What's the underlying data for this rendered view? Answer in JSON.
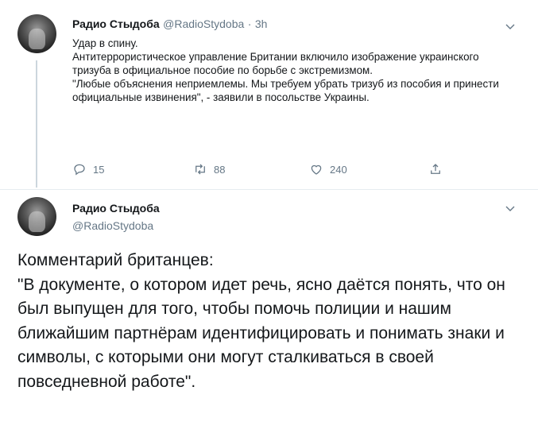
{
  "tweet1": {
    "author_name": "Радио Стыдоба",
    "handle": "@RadioStydoba",
    "separator": "·",
    "time": "3h",
    "body": [
      "Удар в спину.",
      "Антитеррористическое управление Британии включило изображение украинского тризуба в официальное пособие по борьбе с экстремизмом.",
      "\"Любые объяснения неприемлемы. Мы требуем убрать тризуб из пособия и принести официальные извинения\", - заявили в посольстве Украины."
    ],
    "replies": "15",
    "retweets": "88",
    "likes": "240"
  },
  "tweet2": {
    "author_name": "Радио Стыдоба",
    "handle": "@RadioStydoba",
    "body": [
      "Комментарий британцев:",
      "\"В документе, о котором идет речь, ясно даётся понять, что он был выпущен для того, чтобы помочь полиции и нашим ближайшим партнёрам идентифицировать и понимать знаки и символы, с которыми они могут сталкиваться в своей повседневной работе\"."
    ]
  },
  "colors": {
    "text": "#14171a",
    "secondary": "#657786",
    "divider": "#e6ecf0",
    "thread_line": "#ccd6dd"
  },
  "icons": [
    "reply-icon",
    "retweet-icon",
    "like-icon",
    "share-icon",
    "chevron-down-icon",
    "avatar"
  ]
}
